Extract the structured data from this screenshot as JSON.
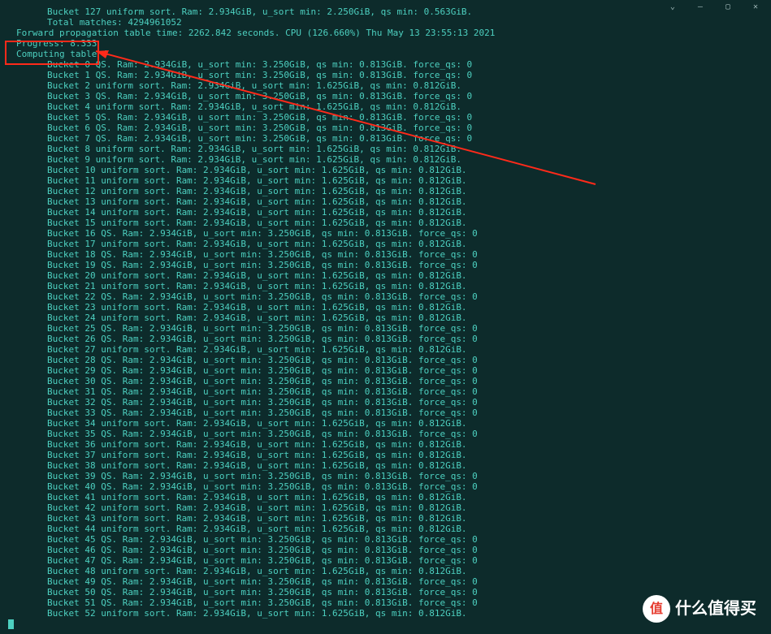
{
  "watermark": {
    "badge": "值",
    "text": "什么值得买"
  },
  "header_lines": [
    {
      "indent": true,
      "t": "Bucket 127 uniform sort. Ram: 2.934GiB, u_sort min: 2.250GiB, qs min: 0.563GiB."
    },
    {
      "indent": true,
      "t": "Total matches: 4294961052"
    },
    {
      "indent": false,
      "t": "Forward propagation table time: 2262.842 seconds. CPU (126.660%) Thu May 13 23:55:13 2021"
    },
    {
      "indent": false,
      "t": "Progress: 8.333"
    },
    {
      "indent": false,
      "t": "Computing table 4"
    }
  ],
  "common": {
    "ram": "2.934GiB",
    "qs_usort": "3.250GiB",
    "qs_qsmin": "0.813GiB",
    "us_usort": "1.625GiB",
    "us_qsmin": "0.812GiB"
  },
  "buckets": [
    {
      "n": 0,
      "t": "qs",
      "force": 0
    },
    {
      "n": 1,
      "t": "qs",
      "force": 0
    },
    {
      "n": 2,
      "t": "us"
    },
    {
      "n": 3,
      "t": "qs",
      "force": 0
    },
    {
      "n": 4,
      "t": "us"
    },
    {
      "n": 5,
      "t": "qs",
      "force": 0
    },
    {
      "n": 6,
      "t": "qs",
      "force": 0
    },
    {
      "n": 7,
      "t": "qs",
      "force": 0
    },
    {
      "n": 8,
      "t": "us"
    },
    {
      "n": 9,
      "t": "us"
    },
    {
      "n": 10,
      "t": "us"
    },
    {
      "n": 11,
      "t": "us"
    },
    {
      "n": 12,
      "t": "us"
    },
    {
      "n": 13,
      "t": "us"
    },
    {
      "n": 14,
      "t": "us"
    },
    {
      "n": 15,
      "t": "us"
    },
    {
      "n": 16,
      "t": "qs",
      "force": 0
    },
    {
      "n": 17,
      "t": "us"
    },
    {
      "n": 18,
      "t": "qs",
      "force": 0
    },
    {
      "n": 19,
      "t": "qs",
      "force": 0
    },
    {
      "n": 20,
      "t": "us"
    },
    {
      "n": 21,
      "t": "us"
    },
    {
      "n": 22,
      "t": "qs",
      "force": 0
    },
    {
      "n": 23,
      "t": "us"
    },
    {
      "n": 24,
      "t": "us"
    },
    {
      "n": 25,
      "t": "qs",
      "force": 0
    },
    {
      "n": 26,
      "t": "qs",
      "force": 0
    },
    {
      "n": 27,
      "t": "us"
    },
    {
      "n": 28,
      "t": "qs",
      "force": 0
    },
    {
      "n": 29,
      "t": "qs",
      "force": 0
    },
    {
      "n": 30,
      "t": "qs",
      "force": 0
    },
    {
      "n": 31,
      "t": "qs",
      "force": 0
    },
    {
      "n": 32,
      "t": "qs",
      "force": 0
    },
    {
      "n": 33,
      "t": "qs",
      "force": 0
    },
    {
      "n": 34,
      "t": "us"
    },
    {
      "n": 35,
      "t": "qs",
      "force": 0
    },
    {
      "n": 36,
      "t": "us"
    },
    {
      "n": 37,
      "t": "us"
    },
    {
      "n": 38,
      "t": "us"
    },
    {
      "n": 39,
      "t": "qs",
      "force": 0
    },
    {
      "n": 40,
      "t": "qs",
      "force": 0
    },
    {
      "n": 41,
      "t": "us"
    },
    {
      "n": 42,
      "t": "us"
    },
    {
      "n": 43,
      "t": "us"
    },
    {
      "n": 44,
      "t": "us"
    },
    {
      "n": 45,
      "t": "qs",
      "force": 0
    },
    {
      "n": 46,
      "t": "qs",
      "force": 0
    },
    {
      "n": 47,
      "t": "qs",
      "force": 0
    },
    {
      "n": 48,
      "t": "us"
    },
    {
      "n": 49,
      "t": "qs",
      "force": 0
    },
    {
      "n": 50,
      "t": "qs",
      "force": 0
    },
    {
      "n": 51,
      "t": "qs",
      "force": 0
    },
    {
      "n": 52,
      "t": "us"
    }
  ]
}
